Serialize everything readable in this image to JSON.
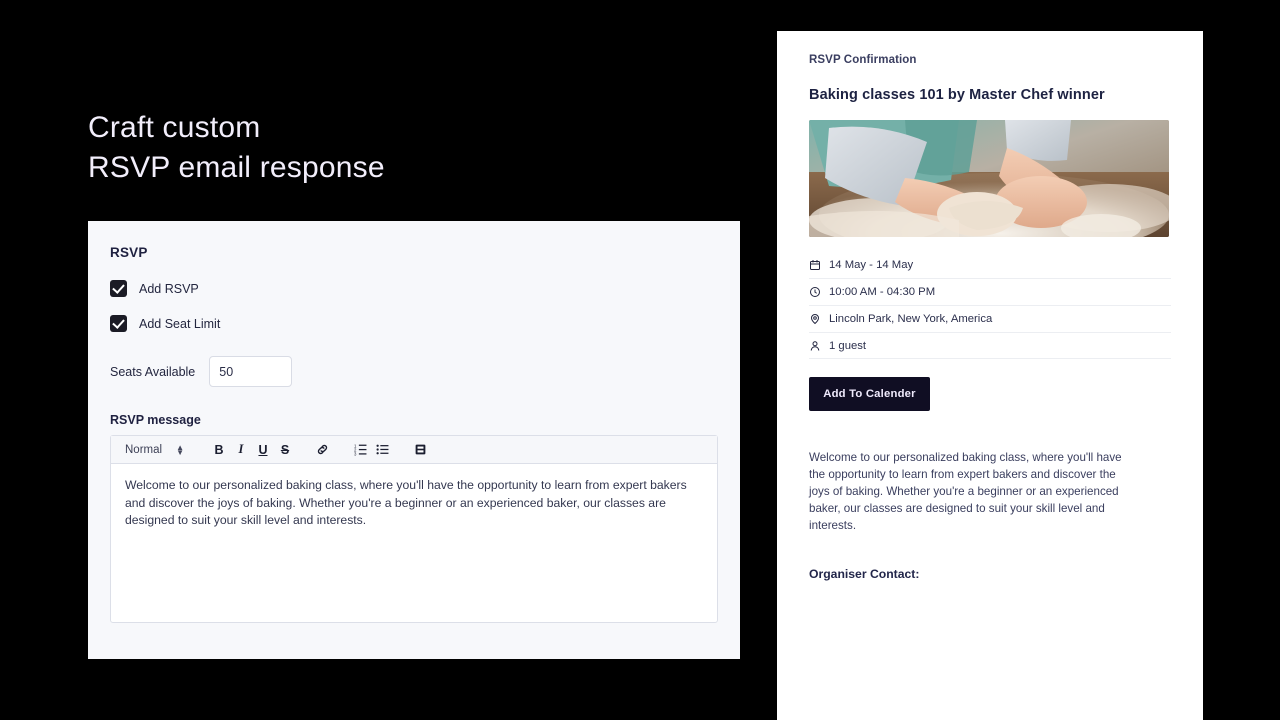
{
  "headline": {
    "line1": "Craft custom",
    "line2": "RSVP email response"
  },
  "form": {
    "section_title": "RSVP",
    "checkboxes": [
      {
        "label": "Add RSVP",
        "checked": true
      },
      {
        "label": "Add Seat Limit",
        "checked": true
      }
    ],
    "seats": {
      "label": "Seats Available",
      "value": "50",
      "placeholder": "Seats"
    },
    "editor": {
      "label": "RSVP message",
      "toolbar": {
        "format_value": "Normal",
        "buttons": [
          {
            "name": "bold-button",
            "glyph": "B"
          },
          {
            "name": "italic-button",
            "glyph": "I"
          },
          {
            "name": "underline-button",
            "glyph": "U"
          },
          {
            "name": "strikethrough-button",
            "glyph": "S"
          }
        ]
      },
      "content": "Welcome to our personalized baking class, where you'll have the opportunity to learn from expert bakers and discover the joys of baking. Whether you're a beginner or an experienced baker, our classes are designed to suit your skill level and interests."
    }
  },
  "preview": {
    "kicker": "RSVP Confirmation",
    "title": "Baking classes 101 by Master Chef winner",
    "image_alt": "Hands kneading dough on a floured wooden board",
    "details": [
      {
        "icon": "calendar-icon",
        "text": "14 May - 14 May"
      },
      {
        "icon": "clock-icon",
        "text": "10:00 AM - 04:30 PM"
      },
      {
        "icon": "location-pin-icon",
        "text": "Lincoln Park, New York, America"
      },
      {
        "icon": "person-icon",
        "text": "1 guest"
      }
    ],
    "calendar_button": "Add To Calender",
    "description": "Welcome to our personalized baking class, where you'll have the opportunity to learn from expert bakers and discover the joys of baking. Whether you're a beginner or an experienced baker, our classes are designed to suit your skill level and interests.",
    "contact_label": "Organiser Contact:"
  },
  "colors": {
    "background": "#000000",
    "headline_text": "#f2eefb",
    "panel_bg": "#f7f8fb",
    "preview_bg": "#ffffff",
    "accent_dark": "#100e23",
    "text_navy": "#1d2242"
  }
}
